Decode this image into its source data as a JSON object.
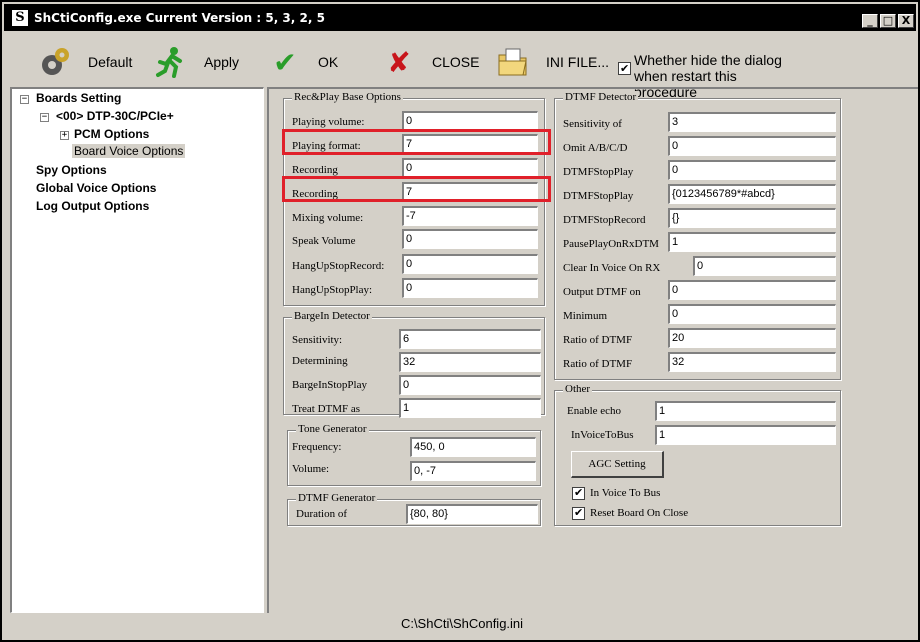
{
  "window": {
    "title": "ShCtiConfig.exe  Current Version : 5, 3, 2, 5"
  },
  "title_buttons": {
    "minimize": "_",
    "maximize": "□",
    "close": "X"
  },
  "toolbar": {
    "default_label": "Default",
    "apply_label": "Apply",
    "ok_label": "OK",
    "close_label": "CLOSE",
    "ini_label": "INI FILE...",
    "hide_dialog_line1": "Whether hide the dialog",
    "hide_dialog_line2": "when restart this procedure",
    "hide_dialog_checked": true,
    "icons": {
      "default": "gear-icon",
      "apply": "running-man-icon",
      "ok": "checkmark-icon",
      "close": "x-mark-icon",
      "ini": "folder-icon"
    }
  },
  "tree": {
    "root": "Boards Setting",
    "board": "<00> DTP-30C/PCIe+",
    "pcm": "PCM Options",
    "board_voice": "Board Voice Options",
    "spy": "Spy Options",
    "global_voice": "Global Voice Options",
    "log_output": "Log Output Options"
  },
  "recplay": {
    "title": "Rec&Play Base Options",
    "fields": [
      {
        "label": "Playing volume:",
        "value": "0"
      },
      {
        "label": "Playing format:",
        "value": "7"
      },
      {
        "label": "Recording",
        "value": "0"
      },
      {
        "label": "Recording",
        "value": "7"
      },
      {
        "label": "Mixing volume:",
        "value": "-7"
      },
      {
        "label": "Speak Volume",
        "value": "0"
      },
      {
        "label": "HangUpStopRecord:",
        "value": "0"
      },
      {
        "label": "HangUpStopPlay:",
        "value": "0"
      }
    ]
  },
  "bargein": {
    "title": "BargeIn Detector",
    "fields": [
      {
        "label": "Sensitivity:",
        "value": "6"
      },
      {
        "label": "Determining",
        "value": "32"
      },
      {
        "label": "BargeInStopPlay",
        "value": "0"
      },
      {
        "label": "Treat DTMF as",
        "value": "1"
      }
    ]
  },
  "tone": {
    "title": "Tone Generator",
    "fields": [
      {
        "label": "Frequency:",
        "value": "450, 0"
      },
      {
        "label": "Volume:",
        "value": "0, -7"
      }
    ]
  },
  "dtmf_gen": {
    "title": "DTMF Generator",
    "fields": [
      {
        "label": "Duration of",
        "value": "{80, 80}"
      }
    ]
  },
  "dtmf_det": {
    "title": "DTMF Detector",
    "fields": [
      {
        "label": "Sensitivity of",
        "value": "3"
      },
      {
        "label": "Omit A/B/C/D",
        "value": "0"
      },
      {
        "label": "DTMFStopPlay",
        "value": "0"
      },
      {
        "label": "DTMFStopPlay",
        "value": "{0123456789*#abcd}"
      },
      {
        "label": "DTMFStopRecord",
        "value": "{}"
      },
      {
        "label": "PausePlayOnRxDTM",
        "value": "1"
      },
      {
        "label": "Clear In Voice On RX",
        "value": "0"
      },
      {
        "label": "Output DTMF on",
        "value": "0"
      },
      {
        "label": "Minimum",
        "value": "0"
      },
      {
        "label": "Ratio of DTMF",
        "value": "20"
      },
      {
        "label": "Ratio of DTMF",
        "value": "32"
      }
    ]
  },
  "other": {
    "title": "Other",
    "fields": [
      {
        "label": "Enable echo",
        "value": "1"
      },
      {
        "label": "InVoiceToBus",
        "value": "1"
      }
    ],
    "agc_button": "AGC Setting",
    "in_voice_to_bus": {
      "label": "In Voice To Bus",
      "checked": true
    },
    "reset_board": {
      "label": "Reset Board On Close",
      "checked": true
    }
  },
  "status": {
    "path": "C:\\ShCti\\ShConfig.ini"
  },
  "colors": {
    "highlight": "#e0202a",
    "titlebar": "#000000",
    "face": "#d4d0c8"
  }
}
